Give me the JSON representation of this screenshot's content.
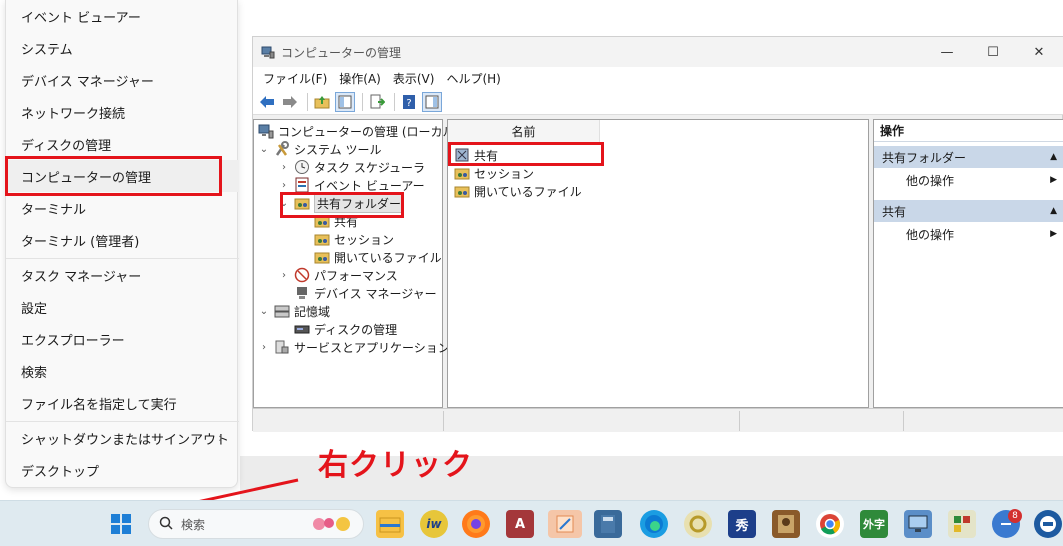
{
  "winx_menu": {
    "items": [
      {
        "label": "イベント ビューアー"
      },
      {
        "label": "システム"
      },
      {
        "label": "デバイス マネージャー"
      },
      {
        "label": "ネットワーク接続"
      },
      {
        "label": "ディスクの管理"
      },
      {
        "label": "コンピューターの管理"
      },
      {
        "label": "ターミナル"
      },
      {
        "label": "ターミナル (管理者)"
      },
      {
        "label": "タスク マネージャー"
      },
      {
        "label": "設定"
      },
      {
        "label": "エクスプローラー"
      },
      {
        "label": "検索"
      },
      {
        "label": "ファイル名を指定して実行"
      },
      {
        "label": "シャットダウンまたはサインアウト",
        "chevron": "›"
      },
      {
        "label": "デスクトップ"
      }
    ]
  },
  "window": {
    "title": "コンピューターの管理",
    "minimize": "—",
    "maximize": "☐",
    "close": "✕",
    "menu": [
      "ファイル(F)",
      "操作(A)",
      "表示(V)",
      "ヘルプ(H)"
    ]
  },
  "tree": {
    "root": "コンピューターの管理 (ローカル)",
    "system_tools": "システム ツール",
    "task_scheduler": "タスク スケジューラ",
    "event_viewer": "イベント ビューアー",
    "shared_folders": "共有フォルダー",
    "shares": "共有",
    "sessions": "セッション",
    "open_files": "開いているファイル",
    "performance": "パフォーマンス",
    "device_manager": "デバイス マネージャー",
    "storage": "記憶域",
    "disk_management": "ディスクの管理",
    "services_apps": "サービスとアプリケーション"
  },
  "list": {
    "column_name": "名前",
    "rows": [
      "共有",
      "セッション",
      "開いているファイル"
    ]
  },
  "actions": {
    "title": "操作",
    "sections": [
      {
        "header": "共有フォルダー",
        "item": "他の操作"
      },
      {
        "header": "共有",
        "item": "他の操作"
      }
    ]
  },
  "annotation": {
    "text": "右クリック",
    "color": "#e4141b"
  },
  "taskbar": {
    "search_placeholder": "検索",
    "badge_count": "8",
    "gaiji_label": "外字"
  }
}
